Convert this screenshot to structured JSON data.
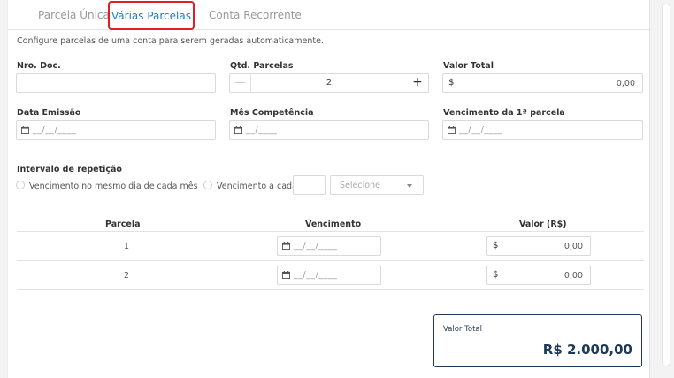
{
  "tabs": [
    {
      "label": "Parcela Única",
      "active": false
    },
    {
      "label": "Várias Parcelas",
      "active": true
    },
    {
      "label": "Conta Recorrente",
      "active": false
    }
  ],
  "description": "Configure parcelas de uma conta para serem geradas automaticamente.",
  "fields": {
    "nro_doc": {
      "label": "Nro. Doc.",
      "value": ""
    },
    "qtd_parcelas": {
      "label": "Qtd. Parcelas",
      "value": "2",
      "minus": "—",
      "plus": "+"
    },
    "valor_total": {
      "label": "Valor Total",
      "currency": "$",
      "value": "0,00"
    },
    "data_emissao": {
      "label": "Data Emissão",
      "placeholder": "__/__/____"
    },
    "mes_competencia": {
      "label": "Mês Competência",
      "placeholder": "__/____"
    },
    "vencimento_primeira": {
      "label": "Vencimento da 1ª parcela",
      "placeholder": "__/__/____"
    }
  },
  "intervalo": {
    "label": "Intervalo de repetição",
    "option_same_day": "Vencimento no mesmo dia de cada mês",
    "option_every": "Vencimento a cada",
    "every_value": "",
    "select_placeholder": "Selecione"
  },
  "table": {
    "headers": [
      "Parcela",
      "Vencimento",
      "Valor (R$)"
    ],
    "rows": [
      {
        "parcela": "1",
        "vencimento": "__/__/____",
        "currency": "$",
        "valor": "0,00"
      },
      {
        "parcela": "2",
        "vencimento": "__/__/____",
        "currency": "$",
        "valor": "0,00"
      }
    ]
  },
  "summary": {
    "label": "Valor Total",
    "value": "R$ 2.000,00"
  },
  "colors": {
    "accent": "#1b7fc1",
    "highlight": "#e02020",
    "dark": "#1f3a55"
  },
  "icons": {
    "calendar": "calendar-icon",
    "caret": "caret-down-icon"
  }
}
